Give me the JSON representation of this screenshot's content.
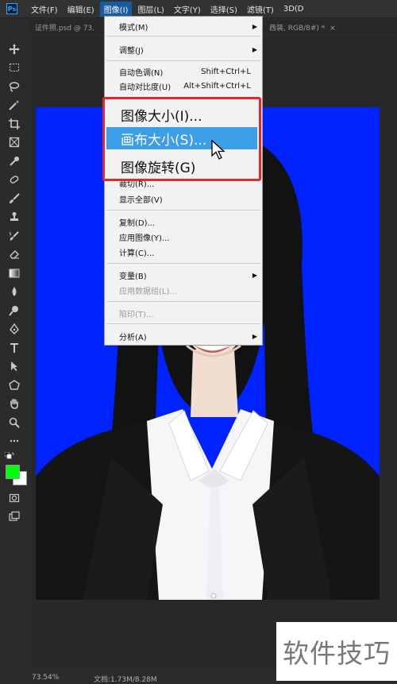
{
  "menubar": {
    "logo": "Ps",
    "items": [
      "文件(F)",
      "编辑(E)",
      "图像(I)",
      "图层(L)",
      "文字(Y)",
      "选择(S)",
      "滤镜(T)",
      "3D(D"
    ]
  },
  "tab": {
    "doc_label": "证件照.psd @ 73.",
    "right_fragment": "西装, RGB/8#) *",
    "close_symbol": "×"
  },
  "image_menu": {
    "mode": "模式(M)",
    "adjust": "调整(J)",
    "auto_tone": "自动色调(N)",
    "auto_tone_shortcut": "Shift+Ctrl+L",
    "auto_contrast": "自动对比度(U)",
    "auto_contrast_shortcut": "Alt+Shift+Ctrl+L",
    "image_size": "图像大小(I)...",
    "canvas_size": "画布大小(S)...",
    "image_rotation": "图像旋转(G)",
    "crop": "裁切(R)...",
    "reveal_all": "显示全部(V)",
    "duplicate": "复制(D)...",
    "apply_image": "应用图像(Y)...",
    "calculations": "计算(C)...",
    "variables": "变量(B)",
    "apply_data_set": "应用数据组(L)...",
    "trap": "陷印(T)...",
    "analysis": "分析(A)"
  },
  "status": {
    "zoom": "73.54%",
    "doc_info": "文档:1.73M/8.28M"
  },
  "watermark": "软件技巧",
  "colors": {
    "menu_active": "#1a5a9f",
    "highlight_border": "#e5262b",
    "hover_item": "#3d9ee8",
    "foreground": "#00ff10",
    "background": "#ffffff",
    "photo_backdrop": "#0022ff"
  },
  "tools": [
    "move-icon",
    "marquee-icon",
    "lasso-icon",
    "magic-wand-icon",
    "crop-icon",
    "frame-icon",
    "eyedropper-icon",
    "healing-icon",
    "brush-icon",
    "stamp-icon",
    "history-brush-icon",
    "eraser-icon",
    "gradient-icon",
    "blur-icon",
    "dodge-icon",
    "pen-icon",
    "type-icon",
    "path-select-icon",
    "shape-icon",
    "hand-icon",
    "zoom-icon",
    "more-icon"
  ]
}
